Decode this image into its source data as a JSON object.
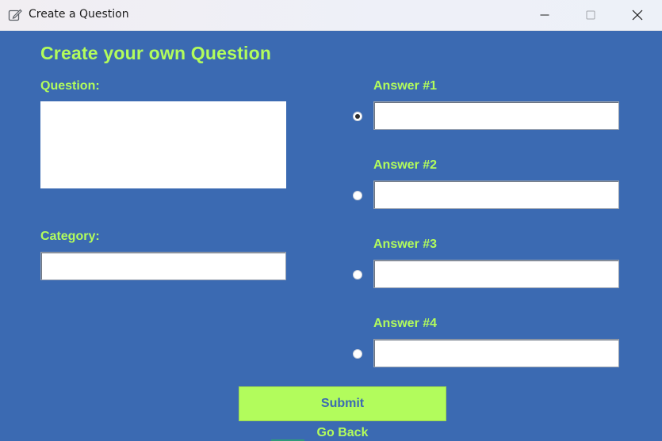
{
  "window": {
    "title": "Create a Question",
    "icon": "edit-note-icon",
    "controls": [
      "minimize-icon",
      "maximize-icon",
      "close-icon"
    ]
  },
  "form": {
    "heading": "Create your own Question",
    "question_label": "Question:",
    "question_value": "",
    "category_label": "Category:",
    "category_value": "",
    "answers": [
      {
        "label": "Answer #1",
        "value": "",
        "selected": true
      },
      {
        "label": "Answer #2",
        "value": "",
        "selected": false
      },
      {
        "label": "Answer #3",
        "value": "",
        "selected": false
      },
      {
        "label": "Answer #4",
        "value": "",
        "selected": false
      }
    ],
    "submit_label": "Submit",
    "go_back_label": "Go Back"
  },
  "colors": {
    "background": "#3b6ab2",
    "accent": "#b2fc5c"
  }
}
